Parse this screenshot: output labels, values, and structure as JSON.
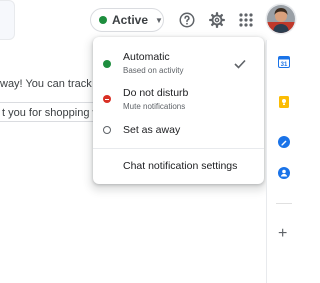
{
  "background": {
    "message_1": "way! You can track it a",
    "message_2": "t you for shopping wit"
  },
  "header": {
    "status": {
      "label": "Active",
      "color": "#1e8e3e"
    },
    "icons": [
      "help-icon",
      "settings-icon",
      "apps-grid-icon",
      "account-avatar-icon"
    ]
  },
  "status_menu": {
    "items": [
      {
        "title": "Automatic",
        "subtitle": "Based on activity",
        "color": "#1e8e3e",
        "selected": true
      },
      {
        "title": "Do not disturb",
        "subtitle": "Mute notifications",
        "color": "#d93025",
        "selected": false
      },
      {
        "title": "Set as away",
        "subtitle": "",
        "color": "#5f6368",
        "selected": false
      }
    ],
    "settings_label": "Chat notification settings"
  },
  "side_panel": {
    "apps": [
      "calendar-icon",
      "keep-icon",
      "tasks-icon",
      "contacts-icon"
    ],
    "add_icon": "add-icon"
  }
}
